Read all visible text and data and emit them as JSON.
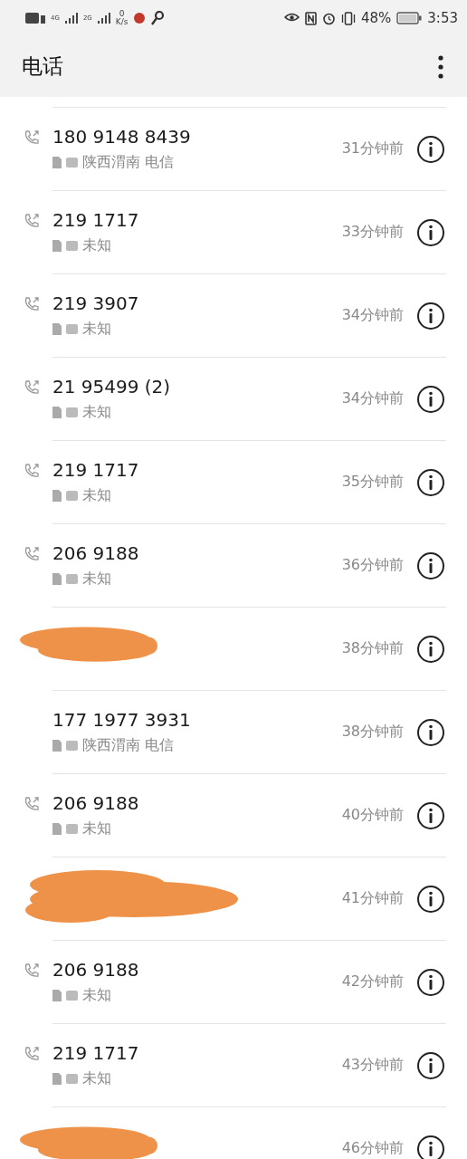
{
  "status_bar": {
    "network_1": "4G",
    "network_2": "2G",
    "speed_value": "0",
    "speed_unit": "K/s",
    "battery": "48%",
    "time": "3:53"
  },
  "header": {
    "title": "电话"
  },
  "calls": [
    {
      "kind": "outgoing",
      "number": "180 9148 8439",
      "location": "陕西渭南 电信",
      "time": "31分钟前"
    },
    {
      "kind": "outgoing",
      "number": "219 1717",
      "location": "未知",
      "time": "33分钟前"
    },
    {
      "kind": "outgoing",
      "number": "219 3907",
      "location": "未知",
      "time": "34分钟前"
    },
    {
      "kind": "outgoing",
      "number": "21 95499 (2)",
      "location": "未知",
      "time": "34分钟前"
    },
    {
      "kind": "outgoing",
      "number": "219 1717",
      "location": "未知",
      "time": "35分钟前"
    },
    {
      "kind": "outgoing",
      "number": "206 9188",
      "location": "未知",
      "time": "36分钟前"
    },
    {
      "kind": "redacted",
      "time": "38分钟前"
    },
    {
      "kind": "plain",
      "number": "177 1977 3931",
      "location": "陕西渭南 电信",
      "time": "38分钟前"
    },
    {
      "kind": "outgoing",
      "number": "206 9188",
      "location": "未知",
      "time": "40分钟前"
    },
    {
      "kind": "redacted",
      "time": "41分钟前"
    },
    {
      "kind": "outgoing",
      "number": "206 9188",
      "location": "未知",
      "time": "42分钟前"
    },
    {
      "kind": "outgoing",
      "number": "219 1717",
      "location": "未知",
      "time": "43分钟前"
    },
    {
      "kind": "redacted",
      "time": "46分钟前"
    }
  ]
}
